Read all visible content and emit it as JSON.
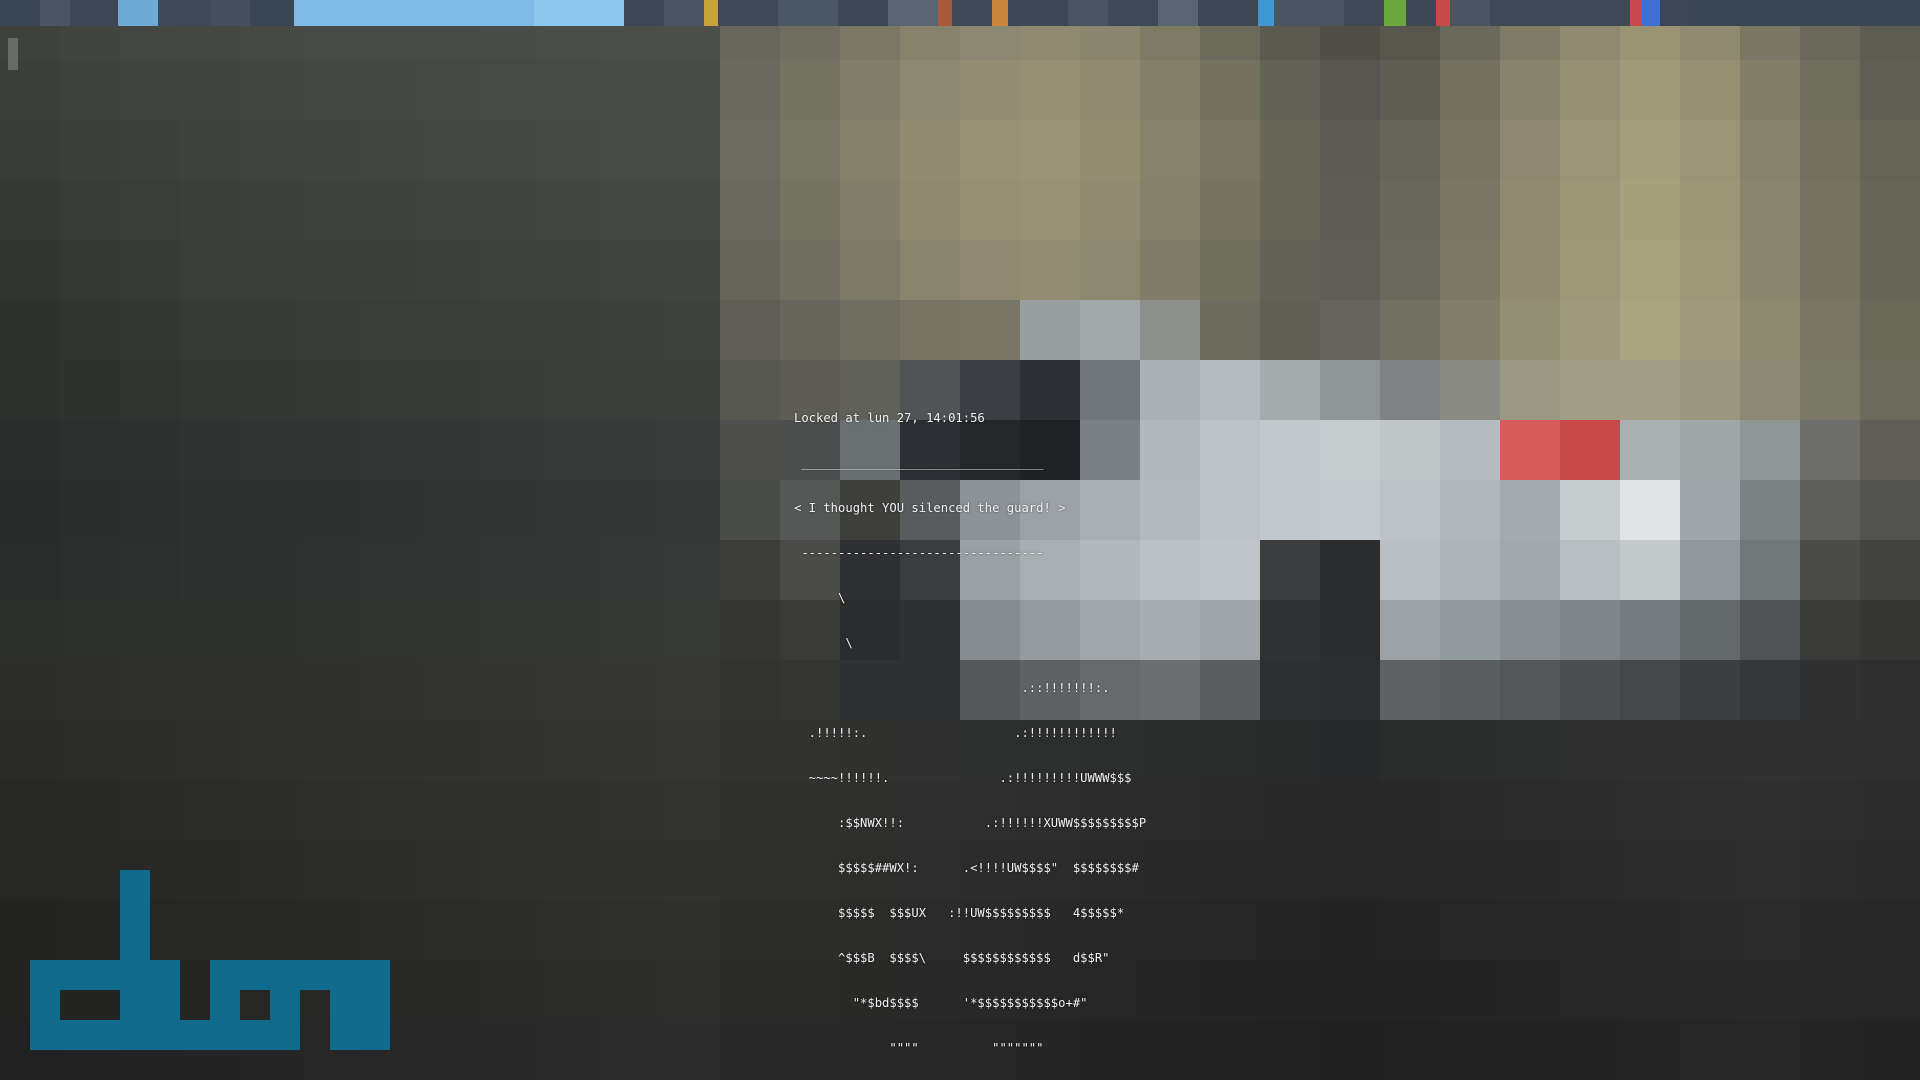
{
  "lock_screen": {
    "locked_text": "Locked at lun 27, 14:01:56",
    "speech_bubble": [
      " _________________________________",
      "< I thought YOU silenced the guard! >",
      " ---------------------------------"
    ],
    "ascii_art": [
      "      \\",
      "       \\",
      "                               .::!!!!!!!:.",
      "  .!!!!!:.                    .:!!!!!!!!!!!!",
      "  ~~~~!!!!!!.               .:!!!!!!!!!UWWW$$$",
      "      :$$NWX!!:           .:!!!!!!XUWW$$$$$$$$$P",
      "      $$$$$##WX!:      .<!!!!UW$$$$\"  $$$$$$$$#",
      "      $$$$$  $$$UX   :!!UW$$$$$$$$$   4$$$$$*",
      "      ^$$$B  $$$$\\     $$$$$$$$$$$$   d$$R\"",
      "        \"*$bd$$$$      '*$$$$$$$$$$$o+#\"",
      "             \"\"\"\"          \"\"\"\"\"\"\""
    ]
  },
  "logo": {
    "text": "dwm",
    "color": "#0f6a8c"
  },
  "wallpaper": {
    "colors": [
      "#3f413d",
      "#42443f",
      "#444641",
      "#454742",
      "#464843",
      "#474944",
      "#484a45",
      "#494b46",
      "#4a4c47",
      "#4b4d48",
      "#4c4e49",
      "#4d4f4a",
      "#67675c",
      "#6f6e60",
      "#7a7865",
      "#86826b",
      "#8c8770",
      "#908a71",
      "#8a856d",
      "#7d7a66",
      "#6c6a5b",
      "#5b5a4f",
      "#4f4f47",
      "#57564d",
      "#6b695c",
      "#7f7b67",
      "#8f8a70",
      "#9a9475",
      "#8f8a70",
      "#7a7664",
      "#6a685a",
      "#5e5d51",
      "#3c3e3a",
      "#3f413c",
      "#41433e",
      "#42443f",
      "#434540",
      "#444641",
      "#454742",
      "#464843",
      "#474944",
      "#484a45",
      "#494b46",
      "#4a4c47",
      "#6a695e",
      "#747263",
      "#807d69",
      "#8c876f",
      "#938d73",
      "#968f74",
      "#8f8a70",
      "#837f69",
      "#74715f",
      "#636256",
      "#575650",
      "#5f5e54",
      "#736f61",
      "#88836c",
      "#968f74",
      "#a19a79",
      "#968f74",
      "#827e68",
      "#6f6d5d",
      "#605f53",
      "#393b37",
      "#3c3e39",
      "#3e403b",
      "#40423d",
      "#41433e",
      "#42443f",
      "#434540",
      "#444641",
      "#454742",
      "#464843",
      "#474944",
      "#484a45",
      "#6d6c60",
      "#787665",
      "#85816b",
      "#918b71",
      "#989175",
      "#9a9376",
      "#938d72",
      "#87836b",
      "#787561",
      "#676658",
      "#5d5c54",
      "#656458",
      "#787464",
      "#8d886f",
      "#9b9476",
      "#a59e7c",
      "#9b9476",
      "#87836b",
      "#737060",
      "#646356",
      "#363834",
      "#393b37",
      "#3b3d39",
      "#3d3f3a",
      "#3e403b",
      "#3f413c",
      "#40423d",
      "#41433e",
      "#42443f",
      "#434540",
      "#444641",
      "#454742",
      "#6a695e",
      "#757364",
      "#827e69",
      "#8e896f",
      "#958f74",
      "#989175",
      "#918b71",
      "#85816a",
      "#76735f",
      "#666557",
      "#5e5d55",
      "#68675b",
      "#7a7665",
      "#8f8a70",
      "#9d9677",
      "#a7a07d",
      "#9d9677",
      "#89856c",
      "#757261",
      "#666557",
      "#333532",
      "#363834",
      "#383a36",
      "#3a3c38",
      "#3b3d39",
      "#3c3e3a",
      "#3d3f3b",
      "#3e403c",
      "#3f413d",
      "#40423e",
      "#41433f",
      "#424440",
      "#66655b",
      "#706e61",
      "#7c7967",
      "#88846d",
      "#8f8a71",
      "#928c73",
      "#8c876f",
      "#807c68",
      "#716f5e",
      "#636256",
      "#5f5e57",
      "#6b695d",
      "#7c7866",
      "#908b71",
      "#9e9778",
      "#a8a17e",
      "#9e9778",
      "#8a866d",
      "#767362",
      "#676658",
      "#303230",
      "#333532",
      "#353734",
      "#373936",
      "#383a37",
      "#393b38",
      "#3a3c39",
      "#3b3d3a",
      "#3c3e3b",
      "#3d3f3c",
      "#3e403d",
      "#3f413e",
      "#5f5f57",
      "#67665c",
      "#6f6e61",
      "#777465",
      "#797667",
      "#9aa0a2",
      "#a3a9ab",
      "#8d8f8c",
      "#6c6b5e",
      "#5f5f56",
      "#65655d",
      "#717062",
      "#807d6b",
      "#938f75",
      "#a09a7c",
      "#a9a380",
      "#a09a7c",
      "#8d896f",
      "#797663",
      "#6a695a",
      "#2e302e",
      "#303230",
      "#323432",
      "#343634",
      "#353735",
      "#363836",
      "#373937",
      "#383a38",
      "#393b39",
      "#3a3c3a",
      "#3b3d3b",
      "#3c3e3c",
      "#585852",
      "#5c5c55",
      "#60615b",
      "#505456",
      "#3c4044",
      "#2d3034",
      "#6f7578",
      "#aab0b3",
      "#b5bbbe",
      "#a6acae",
      "#8f9496",
      "#7e8284",
      "#8a8c84",
      "#9a9884",
      "#a19e86",
      "#a39f86",
      "#9a977f",
      "#8b8873",
      "#7a7866",
      "#6b6a5c",
      "#2b2d2c",
      "#2d2f2e",
      "#2f3130",
      "#313332",
      "#323433",
      "#333534",
      "#343635",
      "#353736",
      "#363837",
      "#373938",
      "#383a39",
      "#393b3a",
      "#4e4f4c",
      "#4d4f4f",
      "#6b7073",
      "#2c2f33",
      "#242629",
      "#1f2124",
      "#7a8083",
      "#b2b8bb",
      "#bcc2c5",
      "#c2c8cb",
      "#c6ccce",
      "#c0c6c8",
      "#b5bbbe",
      "#d65c5c",
      "#c94a4a",
      "#aab0b2",
      "#a0a6a8",
      "#8f9597",
      "#6e6f6a",
      "#5f5f57",
      "#292b2a",
      "#2b2d2c",
      "#2c2e2d",
      "#2e302f",
      "#2f3130",
      "#303231",
      "#313332",
      "#323433",
      "#333534",
      "#343635",
      "#353736",
      "#363837",
      "#4a4c4a",
      "#555857",
      "#3f3f3d",
      "#595c5e",
      "#8c9295",
      "#9ca2a5",
      "#a9afb2",
      "#b4babd",
      "#bcc2c5",
      "#c2c8cb",
      "#c4cacd",
      "#bcc2c5",
      "#b0b6b9",
      "#a4aaad",
      "#c6ccce",
      "#e0e4e6",
      "#9fa5a8",
      "#7c8184",
      "#5e5f5c",
      "#535350",
      "#2a2c2b",
      "#2c2e2d",
      "#2d2f2e",
      "#2f3130",
      "#303231",
      "#313332",
      "#323433",
      "#333534",
      "#343635",
      "#353736",
      "#363837",
      "#373938",
      "#3d3e3c",
      "#4b4c49",
      "#2f3032",
      "#3a3c3e",
      "#9aa0a3",
      "#a8aeb1",
      "#b3b9bc",
      "#bbc1c4",
      "#c0c6c9",
      "#3a3c3e",
      "#2a2c2e",
      "#b8bec1",
      "#aeb4b7",
      "#a2a8ab",
      "#b8bec1",
      "#c4cacc",
      "#91979a",
      "#72777a",
      "#4b4c4a",
      "#434442",
      "#2c2e2c",
      "#2d2f2d",
      "#2e302e",
      "#2f312f",
      "#303230",
      "#313331",
      "#323432",
      "#333533",
      "#343634",
      "#353735",
      "#363836",
      "#373937",
      "#353634",
      "#3a3b39",
      "#2b2c2d",
      "#2e3031",
      "#868c8f",
      "#959b9e",
      "#a0a6a9",
      "#a7adb0",
      "#9ea4a7",
      "#303234",
      "#2a2c2e",
      "#9ba1a4",
      "#939a9d",
      "#888e91",
      "#7f8588",
      "#767c7f",
      "#63686b",
      "#4f5356",
      "#3a3b39",
      "#363735",
      "#2c2d2b",
      "#2d2e2c",
      "#2e2f2d",
      "#2f302e",
      "#30312f",
      "#313230",
      "#323331",
      "#333432",
      "#343533",
      "#353634",
      "#363735",
      "#373836",
      "#333432",
      "#353634",
      "#303132",
      "#2f3031",
      "#55595b",
      "#5e6264",
      "#666a6c",
      "#6b6f71",
      "#5a5e60",
      "#2c2e30",
      "#2b2d2f",
      "#5e6264",
      "#595d5f",
      "#525658",
      "#4b4f51",
      "#44484a",
      "#3c3f41",
      "#353739",
      "#303130",
      "#2e2f2e",
      "#2a2b29",
      "#2b2c2a",
      "#2c2d2b",
      "#2d2e2c",
      "#2e2f2d",
      "#2f302e",
      "#30312f",
      "#313230",
      "#323331",
      "#333432",
      "#343533",
      "#353634",
      "#323331",
      "#323331",
      "#313230",
      "#303130",
      "#2e2f2f",
      "#2d2e2e",
      "#2c2d2d",
      "#2b2c2c",
      "#2a2b2b",
      "#292a2a",
      "#28292a",
      "#2a2b2b",
      "#2b2c2c",
      "#2c2d2d",
      "#2d2e2d",
      "#2e2f2e",
      "#2f302f",
      "#303130",
      "#2e2f2e",
      "#2d2e2d",
      "#282927",
      "#292a28",
      "#2a2b29",
      "#2b2c2a",
      "#2c2d2b",
      "#2d2e2c",
      "#2e2f2d",
      "#2f302e",
      "#30312f",
      "#313230",
      "#323331",
      "#333432",
      "#30312f",
      "#30312f",
      "#2f302e",
      "#2e2f2e",
      "#2d2e2d",
      "#2c2d2c",
      "#2b2c2b",
      "#2a2b2a",
      "#292a29",
      "#282928",
      "#272827",
      "#282928",
      "#292a29",
      "#2a2b2a",
      "#2b2c2b",
      "#2c2d2c",
      "#2d2e2d",
      "#2e2f2e",
      "#2c2d2c",
      "#2b2c2b",
      "#262725",
      "#272826",
      "#282927",
      "#292a28",
      "#2a2b29",
      "#2b2c2a",
      "#2c2d2b",
      "#2d2e2c",
      "#2e2f2d",
      "#2f302e",
      "#30312f",
      "#313230",
      "#2e2f2d",
      "#2e2f2d",
      "#2d2e2c",
      "#2c2d2c",
      "#2b2c2b",
      "#2a2b2a",
      "#292a29",
      "#282928",
      "#272827",
      "#262726",
      "#252625",
      "#262726",
      "#272827",
      "#282928",
      "#292a29",
      "#2a2b2a",
      "#2b2c2b",
      "#2c2d2c",
      "#2a2b2a",
      "#292a29",
      "#242523",
      "#252624",
      "#262725",
      "#272826",
      "#282927",
      "#292a28",
      "#2a2b29",
      "#2b2c2a",
      "#2c2d2b",
      "#2d2e2c",
      "#2e2f2d",
      "#2f302e",
      "#2c2d2b",
      "#2c2d2b",
      "#2b2c2a",
      "#2a2b2a",
      "#292a29",
      "#282928",
      "#272827",
      "#262726",
      "#252625",
      "#242524",
      "#232423",
      "#242524",
      "#252625",
      "#262726",
      "#272827",
      "#282928",
      "#292a29",
      "#2a2b2a",
      "#282928",
      "#272827",
      "#222321",
      "#232422",
      "#242523",
      "#252624",
      "#262725",
      "#272826",
      "#282927",
      "#292a28",
      "#2a2b29",
      "#2b2c2a",
      "#2c2d2b",
      "#2d2e2c",
      "#2a2b29",
      "#2a2b29",
      "#292a28",
      "#282928",
      "#272827",
      "#262726",
      "#252625",
      "#242524",
      "#232423",
      "#222322",
      "#212221",
      "#222322",
      "#232423",
      "#242524",
      "#252625",
      "#262726",
      "#272827",
      "#282928",
      "#262726",
      "#252625",
      "#202120",
      "#212221",
      "#222322",
      "#232423",
      "#242524",
      "#252625",
      "#262726",
      "#272827",
      "#282928",
      "#292a29",
      "#2a2b2a",
      "#2b2c2b",
      "#282928",
      "#282928",
      "#272827",
      "#262726",
      "#252625",
      "#242524",
      "#232423",
      "#222322",
      "#212221",
      "#202120",
      "#1f201f",
      "#202120",
      "#212221",
      "#222322",
      "#232423",
      "#242524",
      "#252625",
      "#262726",
      "#242524",
      "#232423"
    ]
  },
  "statusbar": {
    "segments": [
      {
        "color": "#3a4652",
        "w": 40
      },
      {
        "color": "#4a5561",
        "w": 30
      },
      {
        "color": "#3c4753",
        "w": 48
      },
      {
        "color": "#6fa9d6",
        "w": 40
      },
      {
        "color": "#3e4955",
        "w": 52
      },
      {
        "color": "#444f5b",
        "w": 40
      },
      {
        "color": "#3a4652",
        "w": 44
      },
      {
        "color": "#7fbbe6",
        "w": 240
      },
      {
        "color": "#8ec7ee",
        "w": 90
      },
      {
        "color": "#3c4753",
        "w": 40
      },
      {
        "color": "#4a5561",
        "w": 40
      },
      {
        "color": "#c9a23e",
        "w": 14
      },
      {
        "color": "#3e4955",
        "w": 60
      },
      {
        "color": "#4a5763",
        "w": 60
      },
      {
        "color": "#3c4753",
        "w": 50
      },
      {
        "color": "#5a6470",
        "w": 50
      },
      {
        "color": "#a8593a",
        "w": 14
      },
      {
        "color": "#3e4955",
        "w": 40
      },
      {
        "color": "#c7843a",
        "w": 16
      },
      {
        "color": "#3c4753",
        "w": 60
      },
      {
        "color": "#4a5561",
        "w": 40
      },
      {
        "color": "#3e4955",
        "w": 50
      },
      {
        "color": "#5a6470",
        "w": 40
      },
      {
        "color": "#3c4753",
        "w": 60
      },
      {
        "color": "#3f97d2",
        "w": 16
      },
      {
        "color": "#4a5561",
        "w": 70
      },
      {
        "color": "#3e4955",
        "w": 40
      },
      {
        "color": "#6aa83e",
        "w": 22
      },
      {
        "color": "#3c4753",
        "w": 30
      },
      {
        "color": "#c94a4a",
        "w": 14
      },
      {
        "color": "#4a5561",
        "w": 40
      },
      {
        "color": "#3e4955",
        "w": 140
      },
      {
        "color": "#c94a4a",
        "w": 12
      },
      {
        "color": "#3f6fd2",
        "w": 18
      },
      {
        "color": "#3c4753",
        "w": 30
      }
    ]
  }
}
